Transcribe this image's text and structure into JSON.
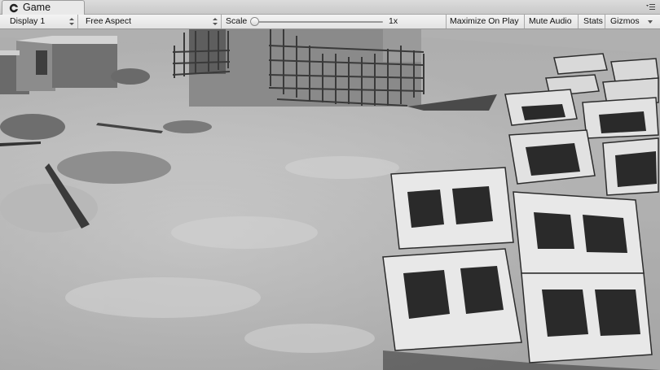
{
  "tab": {
    "title": "Game",
    "icon": "unity-logo-icon"
  },
  "toolbar": {
    "display": "Display 1",
    "aspect": "Free Aspect",
    "scale_label": "Scale",
    "scale_value_label": "1x",
    "scale_fraction": 0.0,
    "maximize_on_play": "Maximize On Play",
    "mute_audio": "Mute Audio",
    "stats": "Stats",
    "gizmos": "Gizmos"
  },
  "viewport": {
    "scene": "grayscale construction site with concrete lattice blocks"
  }
}
